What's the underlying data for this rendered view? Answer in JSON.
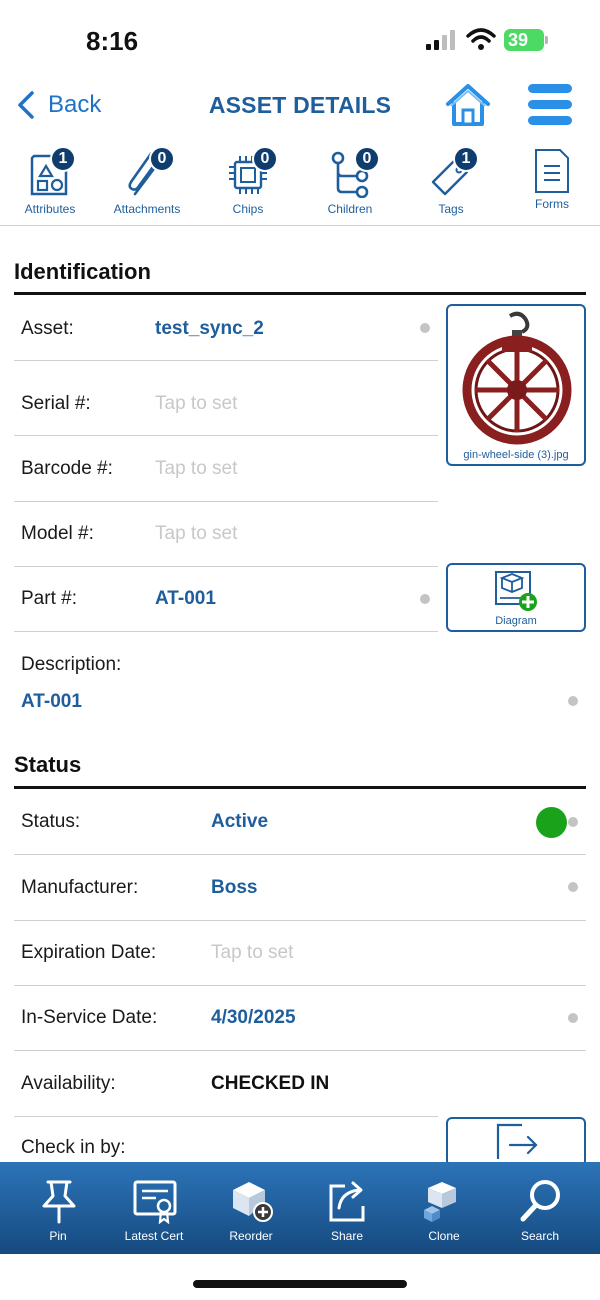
{
  "status_bar": {
    "time": "8:16",
    "battery": "39"
  },
  "nav": {
    "back_label": "Back",
    "title": "ASSET DETAILS"
  },
  "tabs": [
    {
      "label": "Attributes",
      "count": "1",
      "icon": "attributes-icon"
    },
    {
      "label": "Attachments",
      "count": "0",
      "icon": "paperclip-icon"
    },
    {
      "label": "Chips",
      "count": "0",
      "icon": "chip-icon"
    },
    {
      "label": "Children",
      "count": "0",
      "icon": "hierarchy-icon"
    },
    {
      "label": "Tags",
      "count": "1",
      "icon": "tag-icon"
    },
    {
      "label": "Forms",
      "icon": "form-icon"
    }
  ],
  "identification": {
    "title": "Identification",
    "asset_label": "Asset:",
    "asset_value": "test_sync_2",
    "serial_label": "Serial #:",
    "serial_placeholder": "Tap to set",
    "barcode_label": "Barcode #:",
    "barcode_placeholder": "Tap to set",
    "model_label": "Model #:",
    "model_placeholder": "Tap to set",
    "part_label": "Part #:",
    "part_value": "AT-001",
    "description_label": "Description:",
    "description_value": "AT-001",
    "photo_caption": "gin-wheel-side (3).jpg",
    "diagram_label": "Diagram"
  },
  "status": {
    "title": "Status",
    "status_label": "Status:",
    "status_value": "Active",
    "status_color": "#1aa31a",
    "manufacturer_label": "Manufacturer:",
    "manufacturer_value": "Boss",
    "expiration_label": "Expiration Date:",
    "expiration_placeholder": "Tap to set",
    "in_service_label": "In-Service Date:",
    "in_service_value": "4/30/2025",
    "availability_label": "Availability:",
    "availability_value": "CHECKED IN",
    "checkin_label": "Check in by:"
  },
  "toolbar": [
    {
      "label": "Pin",
      "icon": "pin-icon"
    },
    {
      "label": "Latest Cert",
      "icon": "certificate-icon"
    },
    {
      "label": "Reorder",
      "icon": "reorder-icon"
    },
    {
      "label": "Share",
      "icon": "share-icon"
    },
    {
      "label": "Clone",
      "icon": "clone-icon"
    },
    {
      "label": "Search",
      "icon": "search-icon"
    }
  ],
  "colors": {
    "accent": "#1f5e9c",
    "link": "#1f73c7",
    "toolbar_top": "#2c74b8",
    "toolbar_bottom": "#164a80",
    "active": "#1aa31a"
  }
}
